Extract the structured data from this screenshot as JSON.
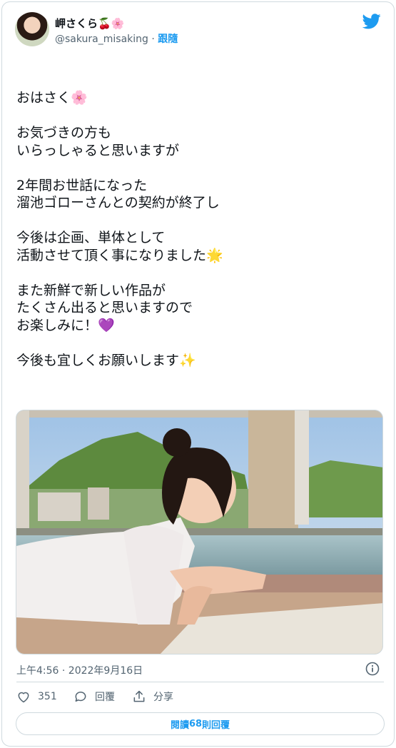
{
  "author": {
    "display_name": "岬さくら🍒🌸",
    "handle": "@sakura_misaking",
    "separator": " · ",
    "follow_label": "跟隨"
  },
  "tweet": {
    "text": "おはさく🌸\n\nお気づきの方も\nいらっしゃると思いますが\n\n2年間お世話になった\n溜池ゴローさんとの契約が終了し\n\n今後は企画、単体として\n活動させて頂く事になりました🌟\n\nまた新鮮で新しい作品が\nたくさん出ると思いますので\nお楽しみに！💜\n\n今後も宜しくお願いします✨",
    "timestamp": "上午4:56 · 2022年9月16日"
  },
  "actions": {
    "like_count": "351",
    "reply_label": "回覆",
    "share_label": "分享"
  },
  "replies_button": {
    "prefix": "閱讀 ",
    "count": "68",
    "suffix": " 則回覆"
  },
  "colors": {
    "accent": "#1d9bf0",
    "text": "#0f1419",
    "muted": "#536471",
    "border": "#cfd9de"
  }
}
